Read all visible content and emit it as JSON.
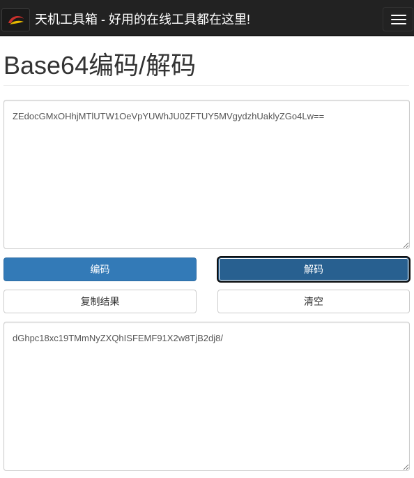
{
  "navbar": {
    "brand_title": "天机工具箱 - 好用的在线工具都在这里!"
  },
  "page": {
    "title": "Base64编码/解码"
  },
  "input": {
    "value": "ZEdocGMxOHhjMTlUTW1OeVpYUWhJU0ZFTUY5MVgydzhUaklyZGo4Lw=="
  },
  "buttons": {
    "encode": "编码",
    "decode": "解码",
    "copy": "复制结果",
    "clear": "清空"
  },
  "output": {
    "value": "dGhpc18xc19TMmNyZXQhISFEMF91X2w8TjB2dj8/"
  },
  "colors": {
    "navbar_bg": "#222222",
    "primary": "#337ab7",
    "primary_active": "#286090"
  }
}
